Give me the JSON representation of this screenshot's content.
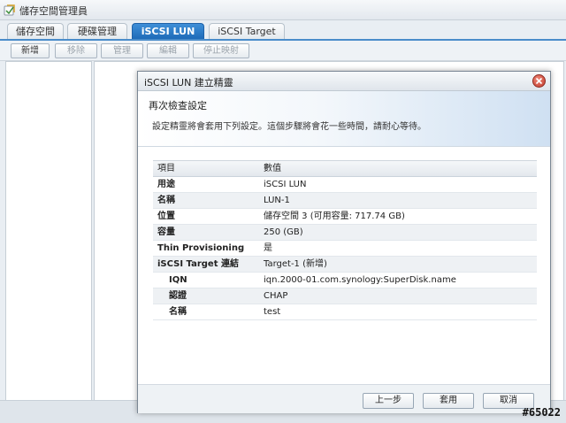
{
  "app": {
    "title": "儲存空間管理員",
    "icon": "storage-manager-icon"
  },
  "tabs": [
    {
      "label": "儲存空間",
      "active": false
    },
    {
      "label": "硬碟管理",
      "active": false
    },
    {
      "label": "iSCSI LUN",
      "active": true
    },
    {
      "label": "iSCSI Target",
      "active": false
    }
  ],
  "toolbar": {
    "add": "新增",
    "remove": "移除",
    "manage": "管理",
    "edit": "編輯",
    "stop_mapping": "停止映射"
  },
  "dialog": {
    "title": "iSCSI LUN 建立精靈",
    "heading": "再次檢查設定",
    "description": "設定精靈將會套用下列設定。這個步驟將會花一些時間，請耐心等待。",
    "table": {
      "headers": [
        "項目",
        "數值"
      ],
      "rows": [
        {
          "key": "用途",
          "value": "iSCSI LUN"
        },
        {
          "key": "名稱",
          "value": "LUN-1"
        },
        {
          "key": "位置",
          "value": "儲存空間 3 (可用容量: 717.74 GB)"
        },
        {
          "key": "容量",
          "value": "250 (GB)"
        },
        {
          "key": "Thin Provisioning",
          "value": "是"
        },
        {
          "key": "iSCSI Target 連結",
          "value": "Target-1 (新增)"
        },
        {
          "key": "IQN",
          "value": "iqn.2000-01.com.synology:SuperDisk.name"
        },
        {
          "key": "認證",
          "value": "CHAP"
        },
        {
          "key": "名稱",
          "value": "test"
        }
      ]
    },
    "buttons": {
      "back": "上一步",
      "apply": "套用",
      "cancel": "取消"
    }
  },
  "watermark": "#65022",
  "colors": {
    "active_tab": "#2a7acb",
    "close_button": "#c0392b"
  }
}
